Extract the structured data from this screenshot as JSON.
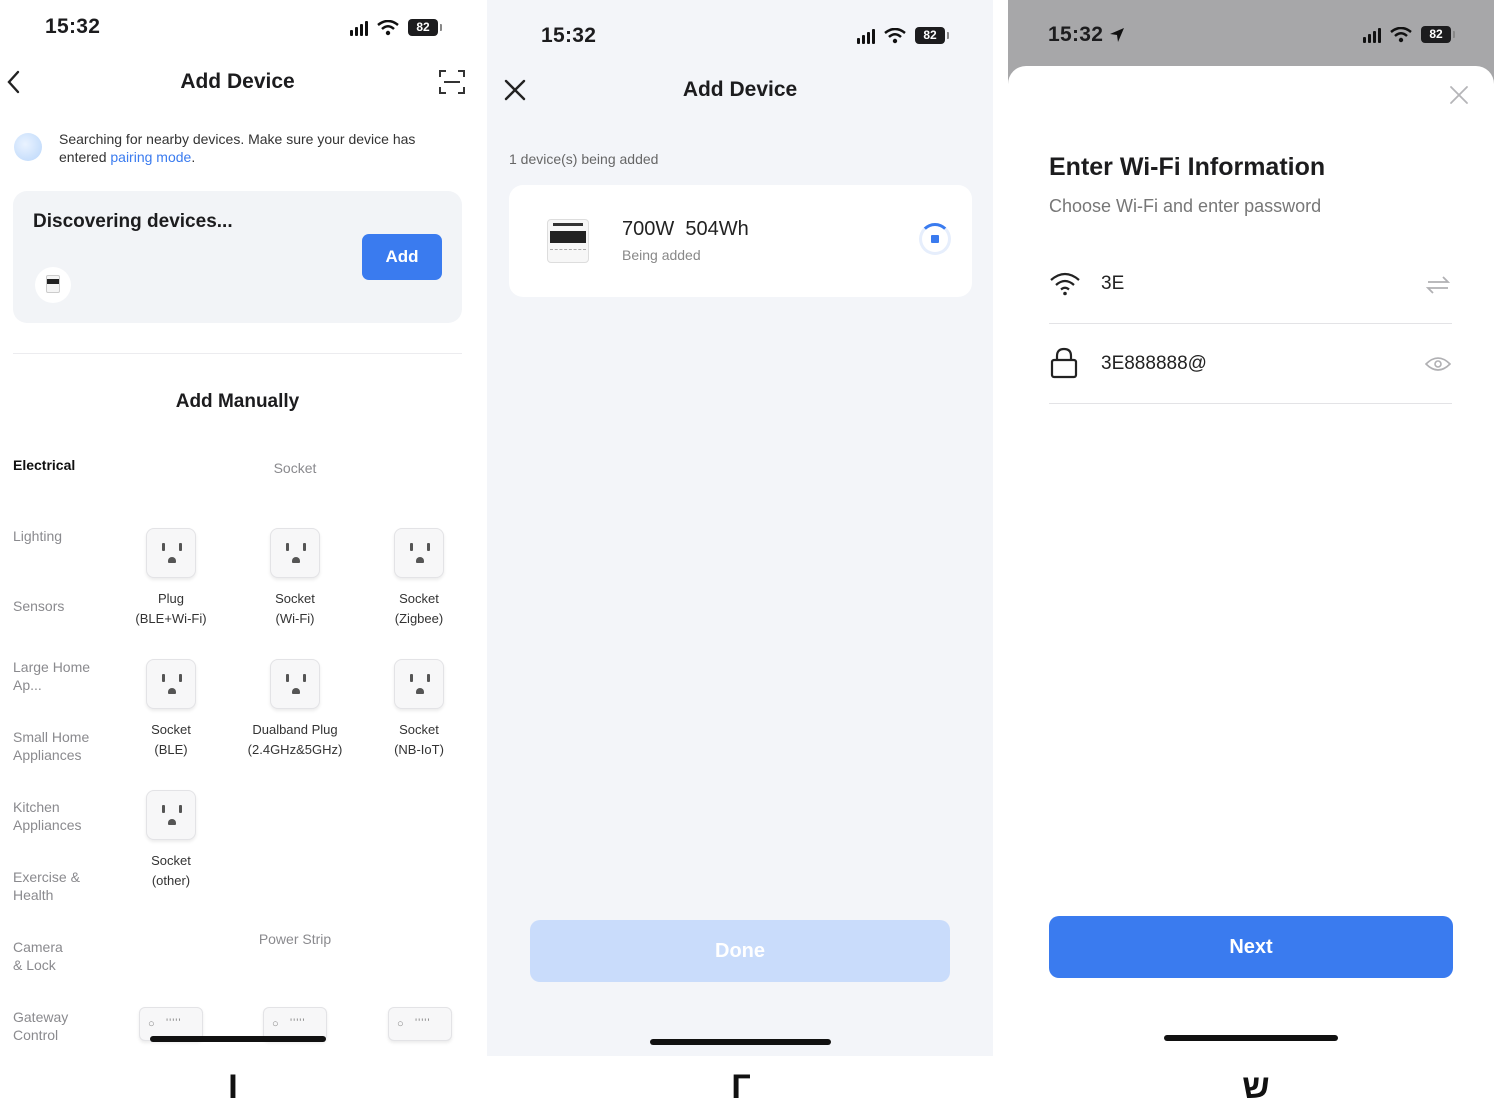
{
  "screen1": {
    "status": {
      "time": "15:32",
      "battery": "82"
    },
    "header": {
      "title": "Add Device"
    },
    "notice": {
      "text": "Searching for nearby devices. Make sure your device has entered ",
      "link": "pairing mode",
      "end": "."
    },
    "discovering": {
      "title": "Discovering devices...",
      "add_label": "Add"
    },
    "manual_title": "Add Manually",
    "categories": [
      "Electrical",
      "Lighting",
      "Sensors",
      "Large Home Ap...",
      "Small Home Appliances",
      "Kitchen Appliances",
      "Exercise & Health",
      "Camera & Lock",
      "Gateway Control"
    ],
    "socket_section": "Socket",
    "devices": [
      {
        "line1": "Plug",
        "line2": "(BLE+Wi-Fi)"
      },
      {
        "line1": "Socket",
        "line2": "(Wi-Fi)"
      },
      {
        "line1": "Socket",
        "line2": "(Zigbee)"
      },
      {
        "line1": "Socket",
        "line2": "(BLE)"
      },
      {
        "line1": "Dualband Plug",
        "line2": "(2.4GHz&5GHz)"
      },
      {
        "line1": "Socket",
        "line2": "(NB-IoT)"
      },
      {
        "line1": "Socket",
        "line2": "(other)"
      }
    ],
    "strip_section": "Power Strip"
  },
  "screen2": {
    "status": {
      "time": "15:32",
      "battery": "82"
    },
    "header": {
      "title": "Add Device"
    },
    "count_text": "1 device(s) being added",
    "device": {
      "name": "700W  504Wh",
      "status": "Being added"
    },
    "done_label": "Done"
  },
  "screen3": {
    "status": {
      "time": "15:32",
      "battery": "82"
    },
    "title": "Enter Wi-Fi Information",
    "subtitle": "Choose Wi-Fi and enter password",
    "ssid": "3E",
    "password": "3E888888@",
    "next_label": "Next"
  },
  "labels": [
    "I",
    "Г",
    "ש"
  ],
  "colors": {
    "accent": "#3a7bef",
    "done_disabled": "#c9dcfb",
    "panel2_bg": "#f3f5f9"
  }
}
